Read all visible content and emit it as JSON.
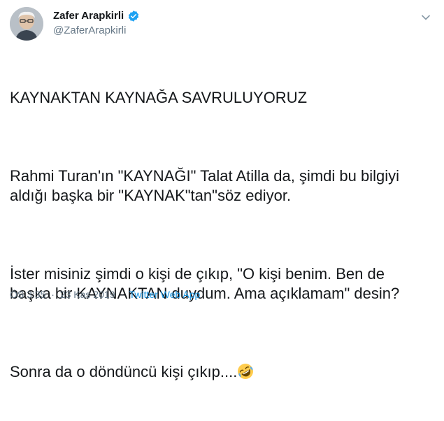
{
  "user": {
    "display_name": "Zafer Arapkirli",
    "handle": "@ZaferArapkirli",
    "verified": true
  },
  "tweet": {
    "paragraphs": [
      "KAYNAKTAN KAYNAĞA SAVRULUYORUZ",
      "Rahmi Turan'ın \"KAYNAĞI\" Talat Atilla da, şimdi bu bilgiyi aldığı başka bir \"KAYNAK\"tan\"söz ediyor.",
      "İster misiniz şimdi o kişi de çıkıp, \"O kişi benim. Ben de başka bir KAYNAKTAN duydum. Ama açıklamam\" desin?",
      "Sonra da o döndüncü kişi çıkıp...."
    ],
    "emoji": "rolling-on-the-floor-laughing"
  },
  "meta": {
    "time": "ÖS 3:35",
    "separator": "·",
    "date": "23 Kas 2019",
    "app": "Twitter Web App"
  },
  "colors": {
    "text": "#14171a",
    "secondary": "#657786",
    "link": "#1b95e0",
    "verified": "#1da1f2"
  }
}
